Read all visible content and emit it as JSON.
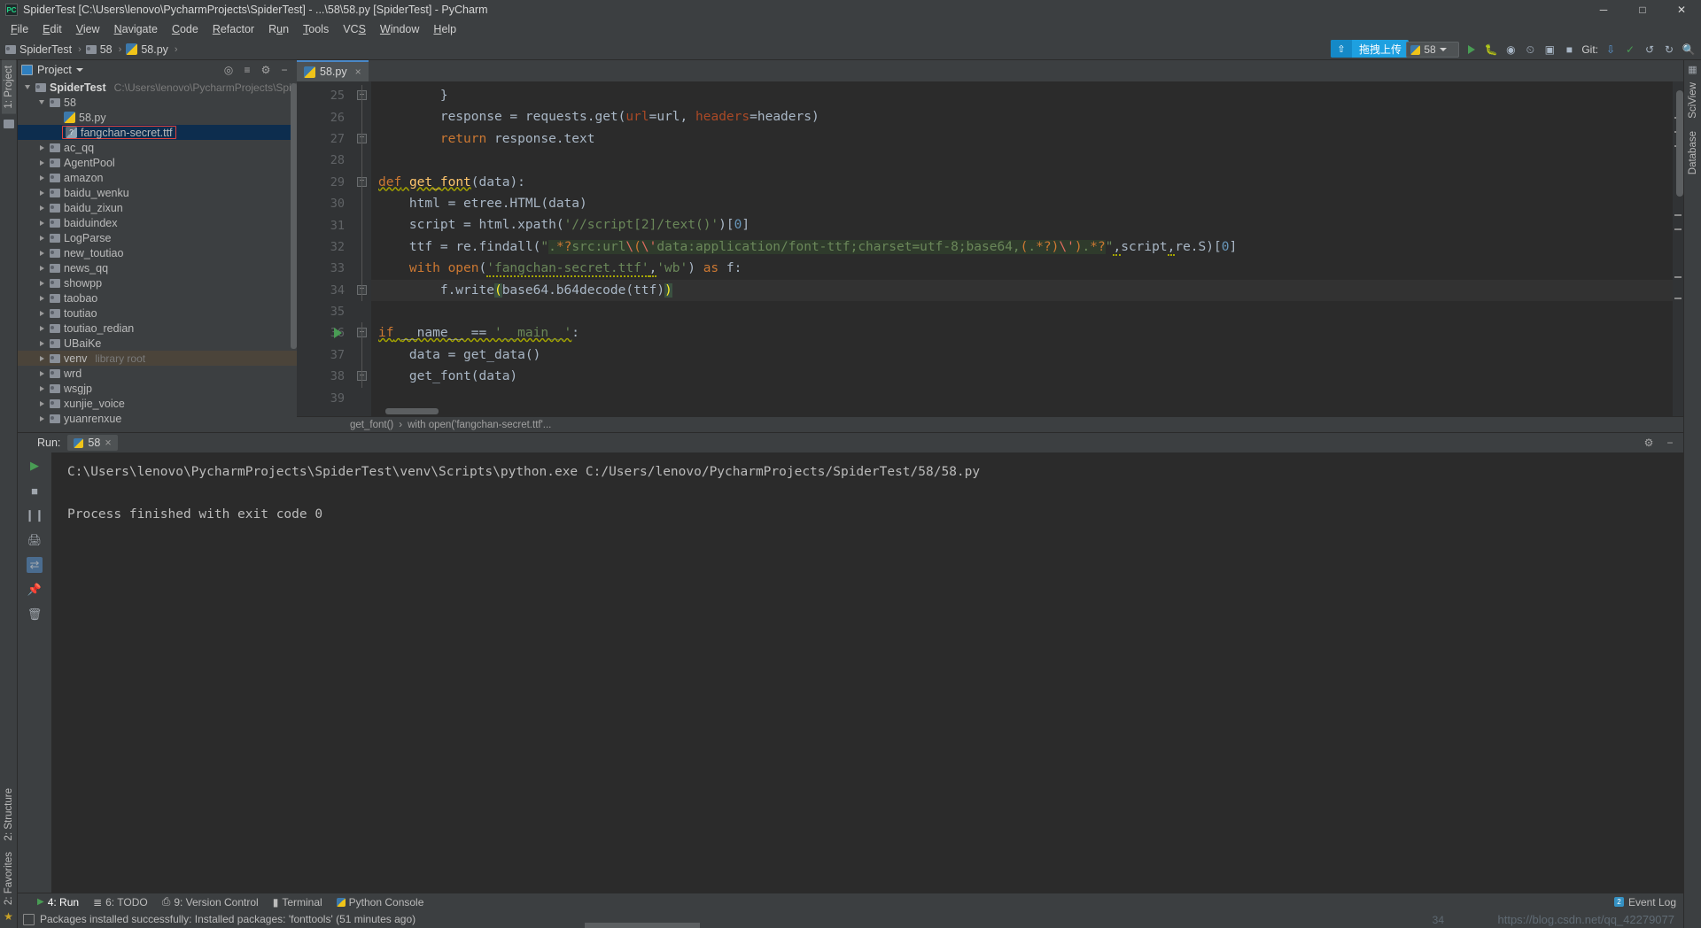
{
  "window": {
    "title": "SpiderTest [C:\\Users\\lenovo\\PycharmProjects\\SpiderTest] - ...\\58\\58.py [SpiderTest] - PyCharm",
    "logo": "PC",
    "minimize": "─",
    "maximize": "□",
    "close": "✕"
  },
  "menu": [
    {
      "label": "File"
    },
    {
      "label": "Edit"
    },
    {
      "label": "View"
    },
    {
      "label": "Navigate"
    },
    {
      "label": "Code"
    },
    {
      "label": "Refactor"
    },
    {
      "label": "Run"
    },
    {
      "label": "Tools"
    },
    {
      "label": "VCS"
    },
    {
      "label": "Window"
    },
    {
      "label": "Help"
    }
  ],
  "navbar": {
    "crumbs": [
      "SpiderTest",
      "58",
      "58.py"
    ],
    "run_config": "58",
    "git_label": "Git:",
    "upload_badge": "拖拽上传"
  },
  "left_strip": {
    "project_tab": "1: Project",
    "structure_tab": "2: Structure",
    "favorites_tab": "2: Favorites"
  },
  "right_strip": {
    "sciview_tab": "SciView",
    "database_tab": "Database"
  },
  "project_panel": {
    "title": "Project",
    "tree": [
      {
        "indent": 0,
        "arrow": "expanded",
        "icon": "folder",
        "label": "SpiderTest",
        "bold": true,
        "sub": "C:\\Users\\lenovo\\PycharmProjects\\SpiderTest"
      },
      {
        "indent": 1,
        "arrow": "expanded",
        "icon": "folder",
        "label": "58"
      },
      {
        "indent": 2,
        "arrow": "none",
        "icon": "python",
        "label": "58.py"
      },
      {
        "indent": 2,
        "arrow": "none",
        "icon": "ttf",
        "label": "fangchan-secret.ttf",
        "selected": true,
        "boxed": true
      },
      {
        "indent": 1,
        "arrow": "collapsed",
        "icon": "folder",
        "label": "ac_qq"
      },
      {
        "indent": 1,
        "arrow": "collapsed",
        "icon": "folder",
        "label": "AgentPool"
      },
      {
        "indent": 1,
        "arrow": "collapsed",
        "icon": "folder",
        "label": "amazon"
      },
      {
        "indent": 1,
        "arrow": "collapsed",
        "icon": "folder",
        "label": "baidu_wenku"
      },
      {
        "indent": 1,
        "arrow": "collapsed",
        "icon": "folder",
        "label": "baidu_zixun"
      },
      {
        "indent": 1,
        "arrow": "collapsed",
        "icon": "folder",
        "label": "baiduindex"
      },
      {
        "indent": 1,
        "arrow": "collapsed",
        "icon": "folder",
        "label": "LogParse"
      },
      {
        "indent": 1,
        "arrow": "collapsed",
        "icon": "folder",
        "label": "new_toutiao"
      },
      {
        "indent": 1,
        "arrow": "collapsed",
        "icon": "folder",
        "label": "news_qq"
      },
      {
        "indent": 1,
        "arrow": "collapsed",
        "icon": "folder",
        "label": "showpp"
      },
      {
        "indent": 1,
        "arrow": "collapsed",
        "icon": "folder",
        "label": "taobao"
      },
      {
        "indent": 1,
        "arrow": "collapsed",
        "icon": "folder",
        "label": "toutiao"
      },
      {
        "indent": 1,
        "arrow": "collapsed",
        "icon": "folder",
        "label": "toutiao_redian"
      },
      {
        "indent": 1,
        "arrow": "collapsed",
        "icon": "folder",
        "label": "UBaiKe"
      },
      {
        "indent": 1,
        "arrow": "collapsed",
        "icon": "folder",
        "label": "venv",
        "sub": "library root",
        "venv": true
      },
      {
        "indent": 1,
        "arrow": "collapsed",
        "icon": "folder",
        "label": "wrd"
      },
      {
        "indent": 1,
        "arrow": "collapsed",
        "icon": "folder",
        "label": "wsgjp"
      },
      {
        "indent": 1,
        "arrow": "collapsed",
        "icon": "folder",
        "label": "xunjie_voice"
      },
      {
        "indent": 1,
        "arrow": "collapsed",
        "icon": "folder",
        "label": "yuanrenxue"
      }
    ]
  },
  "editor": {
    "tab": "58.py",
    "tab_close": "×",
    "first_line_number": 25,
    "lines": [
      {
        "n": 25,
        "fold": "end"
      },
      {
        "n": 26
      },
      {
        "n": 27,
        "fold": "end"
      },
      {
        "n": 28
      },
      {
        "n": 29,
        "fold": "start"
      },
      {
        "n": 30
      },
      {
        "n": 31
      },
      {
        "n": 32
      },
      {
        "n": 33
      },
      {
        "n": 34,
        "fold": "end",
        "highlight": true
      },
      {
        "n": 35
      },
      {
        "n": 36,
        "fold": "start",
        "runmarker": true
      },
      {
        "n": 37
      },
      {
        "n": 38,
        "fold": "end"
      },
      {
        "n": 39
      }
    ],
    "code": {
      "l25": "        }",
      "l26": "        response = requests.get(url=url, headers=headers)",
      "l27": "        return response.text",
      "l28": "",
      "l29": "def get_font(data):",
      "l30": "    html = etree.HTML(data)",
      "l31": "    script = html.xpath('//script[2]/text()')[0]",
      "l32": "    ttf = re.findall(\".*?src:url\\\\(\\\\'data:application/font-ttf;charset=utf-8;base64,(.*?)\\\\'\\\\).*?\",script,re.S)[0]",
      "l33": "    with open('fangchan-secret.ttf','wb') as f:",
      "l34": "        f.write(base64.b64decode(ttf))",
      "l35": "",
      "l36": "if __name__ == '__main__':",
      "l37": "    data = get_data()",
      "l38": "    get_font(data)",
      "l39": ""
    },
    "breadcrumb": [
      "get_font()",
      "with open('fangchan-secret.ttf'..."
    ],
    "breadcrumb_sep": "›"
  },
  "run_panel": {
    "label": "Run:",
    "tab": "58",
    "tab_close": "×",
    "console_lines": [
      "C:\\Users\\lenovo\\PycharmProjects\\SpiderTest\\venv\\Scripts\\python.exe C:/Users/lenovo/PycharmProjects/SpiderTest/58/58.py",
      "",
      "Process finished with exit code 0"
    ]
  },
  "bottom_strip": {
    "items": [
      {
        "label": "4: Run",
        "icon": "run-icon",
        "active": true
      },
      {
        "label": "6: TODO",
        "icon": "todo-icon"
      },
      {
        "label": "9: Version Control",
        "icon": "vcs-icon"
      },
      {
        "label": "Terminal",
        "icon": "terminal-icon"
      },
      {
        "label": "Python Console",
        "icon": "python-console-icon"
      }
    ],
    "event_log": "Event Log",
    "event_log_count": "2"
  },
  "statusbar": {
    "message": "Packages installed successfully: Installed packages: 'fonttools' (51 minutes ago)",
    "watermark": "https://blog.csdn.net/qq_42279077",
    "watermark_prefix": "34"
  }
}
